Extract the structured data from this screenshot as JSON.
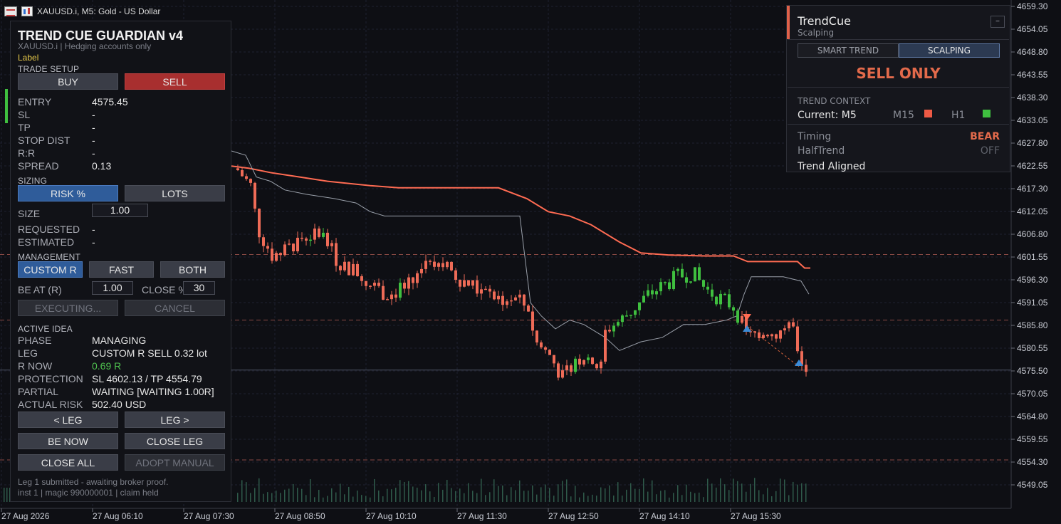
{
  "chart_header": {
    "symbol_line": "XAUUSD.i, M5:  Gold - US Dollar"
  },
  "price_axis": [
    "4659.30",
    "4654.05",
    "4648.80",
    "4643.55",
    "4638.30",
    "4633.05",
    "4627.80",
    "4622.55",
    "4617.30",
    "4612.05",
    "4606.80",
    "4601.55",
    "4596.30",
    "4591.05",
    "4585.80",
    "4580.55",
    "4575.50",
    "4570.05",
    "4564.80",
    "4559.55",
    "4554.30",
    "4549.05"
  ],
  "current_price_label": "4575.50",
  "time_axis": [
    "27 Aug 2026",
    "27 Aug 06:10",
    "27 Aug 07:30",
    "27 Aug 08:50",
    "27 Aug 10:10",
    "27 Aug 11:30",
    "27 Aug 12:50",
    "27 Aug 14:10",
    "27 Aug 15:30"
  ],
  "colors": {
    "bull": "#3fbf3f",
    "bear": "#ee6b57",
    "trail": "#ff6b52",
    "thin_line": "#9aa0aa",
    "grid": "#1e2030"
  },
  "guardian": {
    "title": "TREND CUE GUARDIAN v4",
    "subtitle": "XAUUSD.i  |  Hedging accounts only",
    "label": "Label",
    "trade_setup": "TRADE SETUP",
    "buy": "BUY",
    "sell": "SELL",
    "fields": [
      {
        "k": "ENTRY",
        "v": "4575.45"
      },
      {
        "k": "SL",
        "v": "-"
      },
      {
        "k": "TP",
        "v": "-"
      },
      {
        "k": "STOP DIST",
        "v": "-"
      },
      {
        "k": "R:R",
        "v": "-"
      },
      {
        "k": "SPREAD",
        "v": "0.13"
      }
    ],
    "sizing": "SIZING",
    "risk_pct": "RISK %",
    "lots": "LOTS",
    "size_label": "SIZE",
    "size_value": "1.00",
    "requested_label": "REQUESTED",
    "requested_value": "-",
    "estimated_label": "ESTIMATED",
    "estimated_value": "-",
    "management": "MANAGEMENT",
    "custom_r": "CUSTOM R",
    "fast": "FAST",
    "both": "BOTH",
    "be_at_label": "BE AT (R)",
    "be_at_value": "1.00",
    "close_pct_label": "CLOSE %",
    "close_pct_value": "30",
    "executing": "EXECUTING...",
    "cancel": "CANCEL",
    "active_idea": "ACTIVE IDEA",
    "idea": [
      {
        "k": "PHASE",
        "v": "MANAGING"
      },
      {
        "k": "LEG",
        "v": "CUSTOM R  SELL  0.32 lot"
      },
      {
        "k": "R NOW",
        "v": "0.69 R"
      },
      {
        "k": "PROTECTION",
        "v": "SL 4602.13 / TP 4554.79"
      },
      {
        "k": "PARTIAL",
        "v": "WAITING  [WAITING 1.00R]"
      },
      {
        "k": "ACTUAL RISK",
        "v": "502.40 USD"
      }
    ],
    "prev_leg": "< LEG",
    "next_leg": "LEG >",
    "be_now": "BE NOW",
    "close_leg": "CLOSE LEG",
    "close_all": "CLOSE ALL",
    "adopt_manual": "ADOPT MANUAL",
    "footer1": "Leg 1 submitted - awaiting broker proof.",
    "footer2": "inst 1 | magic 990000001 | claim held"
  },
  "trendcue": {
    "name": "TrendCue",
    "mode": "Scalping",
    "minimize": "–",
    "tab_smart": "SMART TREND",
    "tab_scalping": "SCALPING",
    "signal": "SELL ONLY",
    "context_title": "TREND CONTEXT",
    "current": "Current: M5",
    "m15": "M15",
    "h1": "H1",
    "m15_color": "#ee5a45",
    "h1_color": "#3fbf3f",
    "timing_label": "Timing",
    "timing_value": "BEAR",
    "halftrend_label": "HalfTrend",
    "halftrend_value": "OFF",
    "aligned": "Trend Aligned"
  }
}
